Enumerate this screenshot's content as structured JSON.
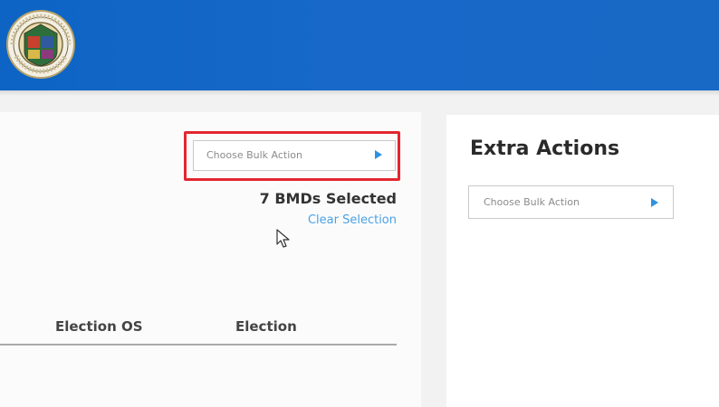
{
  "header": {
    "logo_icon": "county-seal-icon",
    "colors": {
      "bar": "#1767c6"
    }
  },
  "bulk_actions": {
    "placeholder": "Choose Bulk Action",
    "arrow_icon": "caret-right-icon",
    "highlight_color": "#e3262f"
  },
  "selection": {
    "count_text": "7 BMDs Selected",
    "clear_label": "Clear Selection"
  },
  "table": {
    "columns": [
      "Election OS",
      "Election"
    ]
  },
  "extra_actions": {
    "title": "Extra Actions",
    "placeholder": "Choose Bulk Action",
    "arrow_icon": "caret-right-icon"
  }
}
